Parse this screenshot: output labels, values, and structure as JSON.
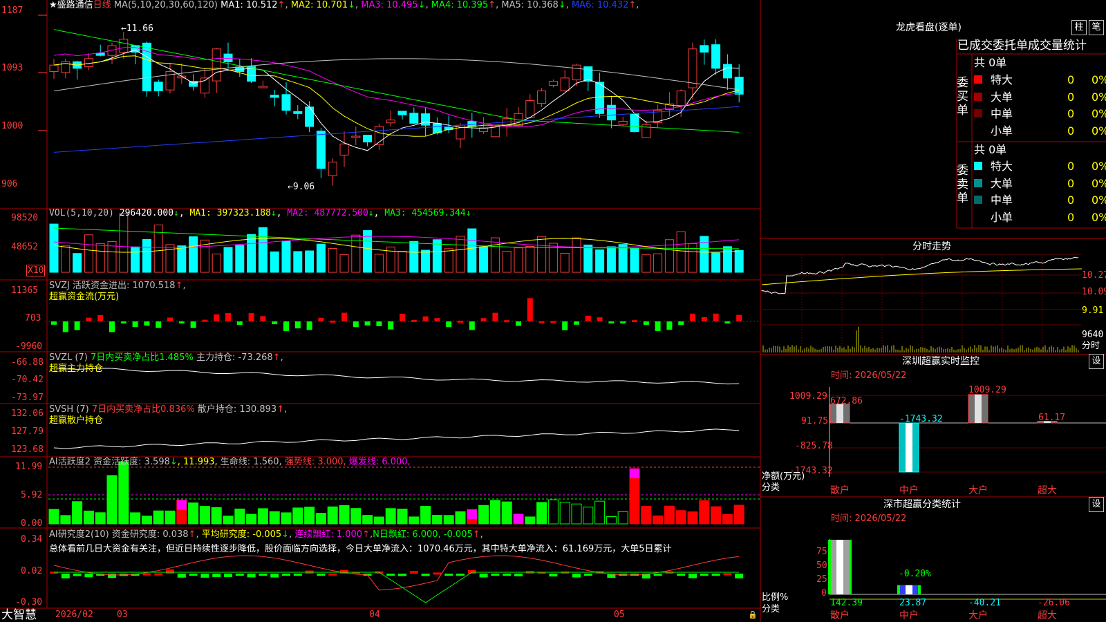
{
  "stock": {
    "star": "★",
    "name": "盛路通信",
    "period": "日线",
    "ma_head": "MA(5,10,20,30,60,120)",
    "ma": [
      {
        "label": "MA1: 10.512",
        "arrow": "↑",
        "color": "#ffffff"
      },
      {
        "label": "MA2: 10.701",
        "arrow": "↓",
        "color": "#ffff00"
      },
      {
        "label": "MA3: 10.495",
        "arrow": "↓",
        "color": "#ff00ff"
      },
      {
        "label": "MA4: 10.395",
        "arrow": "↑",
        "color": "#00ff00"
      },
      {
        "label": "MA5: 10.368",
        "arrow": "↓",
        "color": "#c0c0c0"
      },
      {
        "label": "MA6: 10.432",
        "arrow": "↑",
        "color": "#2040ff"
      }
    ],
    "y_labels": [
      "1187",
      "1093",
      "1000",
      "906"
    ],
    "high_mark": "11.66",
    "low_mark": "9.06"
  },
  "vol": {
    "head": "VOL(5,10,20)",
    "value": "296420.000",
    "v_arrow": "↓",
    "ma1": "MA1: 397323.188",
    "ma1_arrow": "↓",
    "ma2": "MA2: 487772.500",
    "ma2_arrow": "↓",
    "ma3": "MA3: 454569.344",
    "ma3_arrow": "↓",
    "y_labels": [
      "98520",
      "48652"
    ],
    "unit": "X10"
  },
  "svzj": {
    "head": "SVZJ  活跃资金进出: 1070.518",
    "arrow": "↑",
    "sub": "超赢资金流(万元)",
    "y_labels": [
      "11365",
      "703",
      "-9960"
    ]
  },
  "svzl": {
    "head": "SVZL (7)",
    "mid": "7日内买卖净占比1.485%",
    "tail": "主力持仓: -73.268",
    "arrow": "↑",
    "comma": ",",
    "sub": "超赢主力持仓",
    "y_labels": [
      "-66.88",
      "-70.42",
      "-73.97"
    ]
  },
  "svsh": {
    "head": "SVSH (7)",
    "mid": "7日内买卖净占比0.836%",
    "tail": "散户持仓: 130.893",
    "arrow": "↑",
    "comma": ",",
    "sub": "超赢散户持仓",
    "y_labels": [
      "132.06",
      "127.79",
      "123.68"
    ]
  },
  "ai1": {
    "head": "AI活跃度2 资金活跃度: 3.598",
    "a1": "↓",
    "v2": ", 11.993,",
    "v3": "生命线: 1.560,",
    "v4": "强势线: 3.000,",
    "v5": "爆发线: 6.000,",
    "y_labels": [
      "11.99",
      "5.92",
      "0.00"
    ]
  },
  "ai2": {
    "head": "AI研究度2(10) 资金研究度: 0.038",
    "a1": "↑",
    "p2": ",",
    "v2": "平均研究度: -0.005",
    "a2": "↓",
    "p3": ",",
    "v3": "连续飘红: 1.000",
    "a3": "↑",
    "p4": ",",
    "v4": "N日飘红: 6.000, -0.005",
    "a4": "↑",
    "p5": ",",
    "summary": "总体看前几日大资金有关注，但近日持续性逐步降低，股价面临方向选择，今日大单净流入：1070.46万元，其中特大单净流入：61.169万元，大单5日累计",
    "y_labels": [
      "0.34",
      "0.02",
      "-0.30"
    ]
  },
  "bottom": {
    "brand": "大智慧",
    "dates": [
      "2026/02",
      "03",
      "04",
      "05"
    ]
  },
  "longhu": {
    "title": "龙虎看盘(逐单)",
    "btn1": "柱",
    "btn2": "笔",
    "header": "已成交委托单成交量统计",
    "buy": {
      "label": "委买单",
      "total": "共 0单",
      "rows": [
        {
          "name": "特大",
          "color": "#ff0000",
          "v": "0",
          "p": "0%"
        },
        {
          "name": "大单",
          "color": "#a00000",
          "v": "0",
          "p": "0%"
        },
        {
          "name": "中单",
          "color": "#700000",
          "v": "0",
          "p": "0%"
        },
        {
          "name": "小单",
          "color": "#000000",
          "v": "0",
          "p": "0%"
        }
      ]
    },
    "sell": {
      "label": "委卖单",
      "total": "共 0单",
      "rows": [
        {
          "name": "特大",
          "color": "#00ffff",
          "v": "0",
          "p": "0%"
        },
        {
          "name": "大单",
          "color": "#009090",
          "v": "0",
          "p": "0%"
        },
        {
          "name": "中单",
          "color": "#006a6a",
          "v": "0",
          "p": "0%"
        },
        {
          "name": "小单",
          "color": "#000000",
          "v": "0",
          "p": "0%"
        }
      ]
    }
  },
  "intraday": {
    "title": "分时走势",
    "y_labels": [
      "10.27",
      "10.09",
      "9.91",
      "9640"
    ],
    "unit": "分时"
  },
  "sz_monitor": {
    "title": "深圳超赢实时监控",
    "btn": "设",
    "time": "时间: 2026/05/22",
    "y_labels": [
      "1009.29",
      "91.75",
      "-825.78",
      "-1743.32"
    ],
    "net_label": "净额(万元)",
    "cat_label": "分类",
    "bars": [
      {
        "cat": "散户",
        "value": 672.86
      },
      {
        "cat": "中户",
        "value": -1743.32
      },
      {
        "cat": "大户",
        "value": 1009.29
      },
      {
        "cat": "超大",
        "value": 61.17
      }
    ],
    "bar_labels": [
      "672.86",
      "-1743.32",
      "1009.29",
      "61.17"
    ]
  },
  "sz_stats": {
    "title": "深市超赢分类统计",
    "btn": "设",
    "time": "时间: 2026/05/22",
    "y_labels": [
      "75",
      "50",
      "25",
      "0"
    ],
    "ratio_label": "比例%",
    "cat_label": "分类",
    "annot": "-0.20%",
    "values": [
      "142.39",
      "23.87",
      "-40.21",
      "-26.06"
    ],
    "cats": [
      "散户",
      "中户",
      "大户",
      "超大"
    ]
  }
}
